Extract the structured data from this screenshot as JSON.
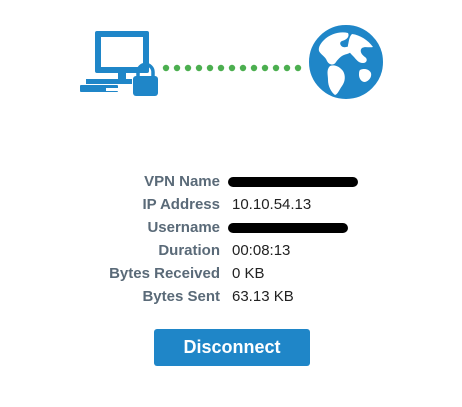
{
  "colors": {
    "icon_blue": "#1f86c8",
    "dots_green": "#4caf50",
    "label_gray": "#5a6a78",
    "button_blue": "#1f86c8"
  },
  "illustration": {
    "left_icon": "computer-lock-icon",
    "connector": "dotted-connection-line",
    "right_icon": "globe-icon"
  },
  "details": {
    "vpn_name": {
      "label": "VPN Name",
      "value": ""
    },
    "ip_address": {
      "label": "IP Address",
      "value": "10.10.54.13"
    },
    "username": {
      "label": "Username",
      "value": ""
    },
    "duration": {
      "label": "Duration",
      "value": "00:08:13"
    },
    "bytes_received": {
      "label": "Bytes Received",
      "value": "0 KB"
    },
    "bytes_sent": {
      "label": "Bytes Sent",
      "value": "63.13 KB"
    }
  },
  "actions": {
    "disconnect_label": "Disconnect"
  }
}
